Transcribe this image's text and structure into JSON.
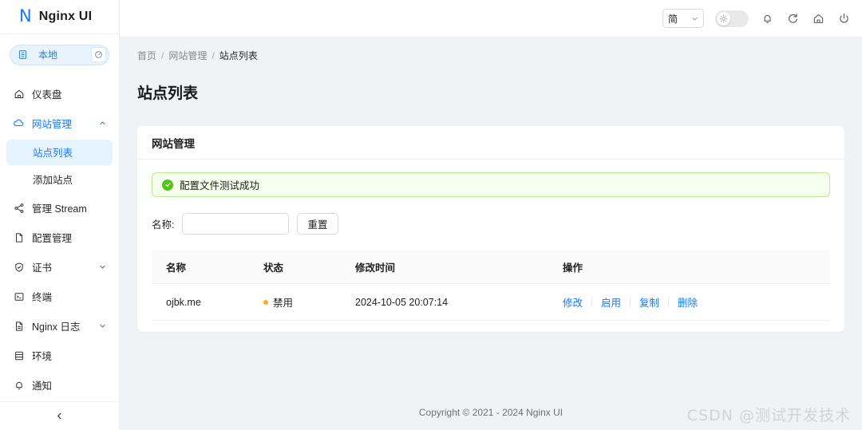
{
  "app": {
    "logo_mark": "N",
    "logo_text": "Nginx UI"
  },
  "sidebar": {
    "env_pill": {
      "label": "本地",
      "db_icon": "database-icon",
      "gauge_icon": "gauge-icon"
    },
    "items": [
      {
        "label": "仪表盘",
        "icon": "home-icon",
        "type": "item"
      },
      {
        "label": "网站管理",
        "icon": "cloud-icon",
        "type": "parent",
        "expanded": true,
        "caret": "chevron-up-icon"
      },
      {
        "label": "站点列表",
        "icon": "",
        "type": "sub",
        "selected": true
      },
      {
        "label": "添加站点",
        "icon": "",
        "type": "sub",
        "selected": false
      },
      {
        "label": "管理 Stream",
        "icon": "share-icon",
        "type": "item"
      },
      {
        "label": "配置管理",
        "icon": "file-icon",
        "type": "item"
      },
      {
        "label": "证书",
        "icon": "shield-check-icon",
        "type": "parent",
        "expanded": false,
        "caret": "chevron-down-icon"
      },
      {
        "label": "终端",
        "icon": "terminal-icon",
        "type": "item"
      },
      {
        "label": "Nginx 日志",
        "icon": "file-text-icon",
        "type": "parent",
        "expanded": false,
        "caret": "chevron-down-icon"
      },
      {
        "label": "环境",
        "icon": "server-icon",
        "type": "item"
      },
      {
        "label": "通知",
        "icon": "bell-icon",
        "type": "item"
      }
    ],
    "collapse_icon": "chevron-left-icon"
  },
  "topbar": {
    "language": {
      "value": "简",
      "caret": "chevron-down-icon"
    },
    "theme_toggle": {
      "icon": "sun-icon",
      "state": "light"
    },
    "icons": [
      {
        "name": "bell-icon"
      },
      {
        "name": "refresh-icon"
      },
      {
        "name": "home-icon"
      },
      {
        "name": "logout-icon"
      }
    ]
  },
  "breadcrumb": {
    "items": [
      "首页",
      "网站管理",
      "站点列表"
    ],
    "separator": "/"
  },
  "page": {
    "title": "站点列表"
  },
  "card": {
    "title": "网站管理",
    "alert": {
      "type": "success",
      "icon": "check-circle-icon",
      "message": "配置文件测试成功",
      "bg_color": "#f6ffed",
      "border_color": "#b7eb8f",
      "icon_color": "#52c41a"
    },
    "filter": {
      "name_label": "名称:",
      "name_value": "",
      "name_placeholder": "",
      "reset_label": "重置"
    },
    "table": {
      "columns": [
        "名称",
        "状态",
        "修改时间",
        "操作"
      ],
      "rows": [
        {
          "name": "ojbk.me",
          "status": "禁用",
          "status_color": "#faad14",
          "modified": "2024-10-05 20:07:14",
          "actions": [
            "修改",
            "启用",
            "复制",
            "删除"
          ]
        }
      ]
    }
  },
  "footer": {
    "copyright": "Copyright © 2021 - 2024 Nginx UI",
    "watermark": "CSDN @测试开发技术"
  },
  "colors": {
    "primary": "#1677ff",
    "active_bg": "#e6f4ff",
    "page_bg": "#f0f2f5",
    "warning": "#faad14",
    "success": "#52c41a"
  }
}
